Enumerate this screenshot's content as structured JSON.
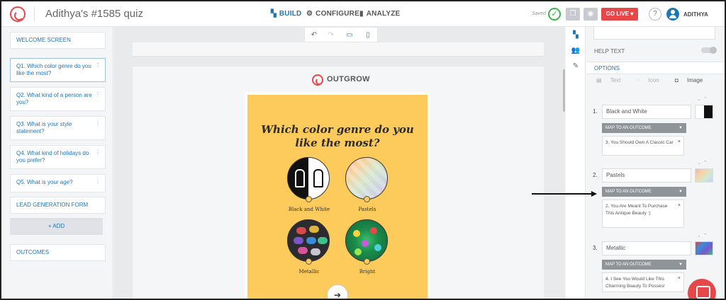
{
  "header": {
    "title": "Adithya's #1585 quiz",
    "nav": {
      "build": "BUILD",
      "configure": "CONFIGURE",
      "analyze": "ANALYZE"
    },
    "saved": "Saved",
    "go_live": "GO LIVE ▾",
    "help": "?",
    "username": "ADITHYA"
  },
  "sidebar": {
    "welcome": "WELCOME SCREEN",
    "questions": [
      {
        "label": "Q1. Which color genre do you like the most?",
        "dots": "⋮"
      },
      {
        "label": "Q2. What kind of a person are you?",
        "dots": "⋮"
      },
      {
        "label": "Q3. What is your style statement?",
        "dots": "⋮"
      },
      {
        "label": "Q4. What kind of holidays do you prefer?",
        "dots": "⋮"
      },
      {
        "label": "Q5. What is your age?",
        "dots": "⋮"
      }
    ],
    "lead_form": "LEAD GENERATION FORM",
    "add": "+ ADD",
    "outcomes": "OUTCOMES"
  },
  "canvas": {
    "brand": "OUTGROW",
    "question": "Which color genre do you like the most?",
    "options": [
      {
        "label": "Black and White"
      },
      {
        "label": "Pastels"
      },
      {
        "label": "Metallic"
      },
      {
        "label": "Bright"
      }
    ],
    "card_bg": "#fccb5b"
  },
  "panel": {
    "help_text": "HELP TEXT",
    "options_title": "OPTIONS",
    "types": {
      "text": "Text",
      "icon": "Icon",
      "image": "Image"
    },
    "map_label": "MAP TO AN OUTCOME",
    "items": [
      {
        "num": "1.",
        "value": "Black and White",
        "outcome": "3. You Should Own A Classic Car"
      },
      {
        "num": "2.",
        "value": "Pastels",
        "outcome": "2. You Are Meant To Purchase This Antique Beauty :)"
      },
      {
        "num": "3.",
        "value": "Metallic",
        "outcome": "4. I See You Would Like This Charming Beauty To Posses!"
      }
    ]
  },
  "colors": {
    "brand_red": "#e8474a",
    "accent_blue": "#1f76b6",
    "saved_green": "#3bb449"
  }
}
